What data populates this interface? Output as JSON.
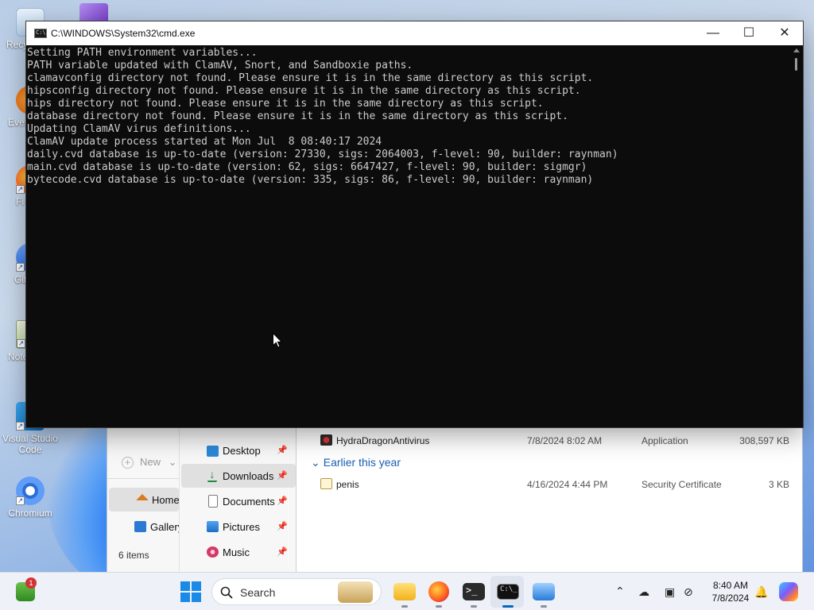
{
  "desktop": {
    "icons": [
      {
        "label": "Recy"
      },
      {
        "label": "Ever"
      },
      {
        "label": "Fi"
      },
      {
        "label": "Git"
      },
      {
        "label": "Note"
      },
      {
        "label": "Visual Studio Code"
      },
      {
        "label": "Chromium"
      }
    ]
  },
  "cmd": {
    "title": "C:\\WINDOWS\\System32\\cmd.exe",
    "output_lines": [
      "Setting PATH environment variables...",
      "PATH variable updated with ClamAV, Snort, and Sandboxie paths.",
      "clamavconfig directory not found. Please ensure it is in the same directory as this script.",
      "hipsconfig directory not found. Please ensure it is in the same directory as this script.",
      "hips directory not found. Please ensure it is in the same directory as this script.",
      "database directory not found. Please ensure it is in the same directory as this script.",
      "Updating ClamAV virus definitions...",
      "ClamAV update process started at Mon Jul  8 08:40:17 2024",
      "daily.cvd database is up-to-date (version: 27330, sigs: 2064003, f-level: 90, builder: raynman)",
      "main.cvd database is up-to-date (version: 62, sigs: 6647427, f-level: 90, builder: sigmgr)",
      "bytecode.cvd database is up-to-date (version: 335, sigs: 86, f-level: 90, builder: raynman)"
    ],
    "minimize": "—",
    "maximize": "☐",
    "close": "✕"
  },
  "explorer": {
    "new_label": "New",
    "new_caret": "⌄",
    "home_label": "Home",
    "gallery_label": "Gallery",
    "items_count": "6 items",
    "nav": [
      {
        "label": "Desktop",
        "pinned": true
      },
      {
        "label": "Downloads",
        "pinned": true
      },
      {
        "label": "Documents",
        "pinned": true
      },
      {
        "label": "Pictures",
        "pinned": true
      },
      {
        "label": "Music",
        "pinned": true
      }
    ],
    "pin_glyph": "📌",
    "files_top": {
      "name": "HydraDragonAntivirus",
      "date": "7/8/2024 8:02 AM",
      "type": "Application",
      "size": "308,597 KB"
    },
    "group_header": "Earlier this year",
    "group_chevron": "⌄",
    "files_group": {
      "name": "penis",
      "date": "4/16/2024 4:44 PM",
      "type": "Security Certificate",
      "size": "3 KB"
    }
  },
  "taskbar": {
    "search_label": "Search",
    "notification_badge": "1",
    "time": "8:40 AM",
    "date": "7/8/2024",
    "tray_chevron": "⌃"
  },
  "colors": {
    "terminal_bg": "#0c0c0c",
    "terminal_fg": "#cccccc",
    "accent": "#0067c0"
  }
}
